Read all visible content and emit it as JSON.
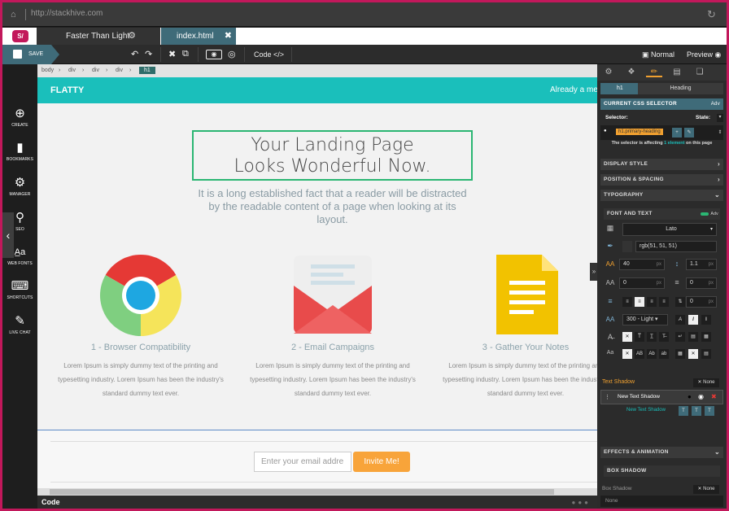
{
  "browser": {
    "url": "http://stackhive.com"
  },
  "tabs": [
    {
      "label": "Faster Than Light"
    },
    {
      "label": "index.html"
    }
  ],
  "toolbar": {
    "save_label": "SAVE",
    "code_label": "Code",
    "view_mode": "Normal",
    "preview_label": "Preview"
  },
  "sidebar": {
    "items": [
      {
        "label": "CREATE",
        "icon": "plus-circle-icon"
      },
      {
        "label": "BOOKMARKS",
        "icon": "bookmark-icon"
      },
      {
        "label": "MANAGER",
        "icon": "gears-icon"
      },
      {
        "label": "SEO",
        "icon": "search-icon"
      },
      {
        "label": "WEB FONTS",
        "icon": "font-icon"
      },
      {
        "label": "SHORTCUTS",
        "icon": "keyboard-icon"
      },
      {
        "label": "LIVE CHAT",
        "icon": "chat-icon"
      }
    ]
  },
  "breadcrumb": [
    "body",
    "div",
    "div",
    "div",
    "h1"
  ],
  "page": {
    "brand": "FLATTY",
    "nav_text": "Already a mem",
    "headline_line1": "Your Landing Page",
    "headline_line2": "Looks Wonderful Now.",
    "subtext": "It is a long established fact that a reader will be distracted by the readable content of a page when looking at its layout.",
    "features": [
      {
        "title": "1 - Browser Compatibility",
        "desc": "Lorem Ipsum is simply dummy text of the printing and typesetting industry. Lorem Ipsum has been the industry's standard dummy text ever.",
        "icon": "chrome-icon"
      },
      {
        "title": "2 - Email Campaigns",
        "desc": "Lorem Ipsum is simply dummy text of the printing and typesetting industry. Lorem Ipsum has been the industry's standard dummy text ever.",
        "icon": "envelope-icon"
      },
      {
        "title": "3 - Gather Your Notes",
        "desc": "Lorem Ipsum is simply dummy text of the printing and typesetting industry. Lorem Ipsum has been the industry's standard dummy text ever.",
        "icon": "notes-icon"
      }
    ],
    "email_placeholder": "Enter your email addre",
    "invite_label": "Invite Me!"
  },
  "codebar": {
    "label": "Code"
  },
  "panel": {
    "tag_label": "h1",
    "tag_type": "Heading",
    "current_selector_title": "CURRENT CSS SELECTOR",
    "adv_label": "Adv",
    "selector_label": "Selector:",
    "state_label": "State:",
    "selector_value": "h1.primary-heading",
    "affecting_pre": "The selector is affecting",
    "affecting_count": "1 element",
    "affecting_post": "on this page",
    "sections": {
      "display": "DISPLAY STYLE",
      "position": "POSITION & SPACING",
      "typography": "TYPOGRAPHY",
      "font_text": "FONT AND TEXT",
      "effects": "EFFECTS & ANIMATION",
      "box_shadow": "BOX SHADOW"
    },
    "font_family": "Lato",
    "color_value": "rgb(51, 51, 51)",
    "font_size": "40",
    "line_height": "1.1",
    "letter_spacing": "0",
    "word_spacing": "0",
    "weight": "300 - Light",
    "unit_px": "px",
    "text_shadow_label": "Text Shadow",
    "none_label": "None",
    "shadow_item": "New Text Shadow",
    "new_shadow_label": "New Text Shadow",
    "box_shadow_label": "Box Shadow",
    "box_shadow_value": "None"
  }
}
